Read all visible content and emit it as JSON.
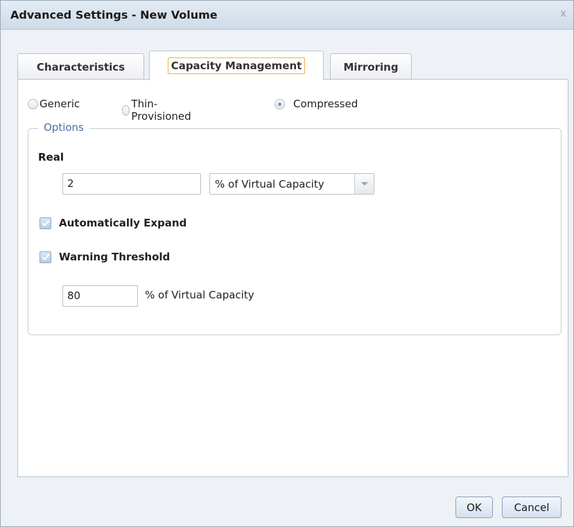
{
  "window": {
    "title": "Advanced Settings - New Volume",
    "close_glyph": "x"
  },
  "tabs": [
    {
      "label": "Characteristics",
      "active": false
    },
    {
      "label": "Capacity Management",
      "active": true
    },
    {
      "label": "Mirroring",
      "active": false
    }
  ],
  "provisioning": {
    "options": [
      {
        "label": "Generic",
        "checked": false
      },
      {
        "label": "Thin-Provisioned",
        "checked": false
      },
      {
        "label": "Compressed",
        "checked": true
      }
    ]
  },
  "options_group": {
    "legend": "Options",
    "real": {
      "label": "Real",
      "value": "2",
      "unit_selected": "% of Virtual Capacity"
    },
    "auto_expand": {
      "label": "Automatically Expand",
      "checked": true
    },
    "warning": {
      "label": "Warning Threshold",
      "checked": true,
      "value": "80",
      "unit": "% of Virtual Capacity"
    }
  },
  "buttons": {
    "ok": "OK",
    "cancel": "Cancel"
  },
  "colors": {
    "accent_focus": "#f2b046",
    "legend_text": "#4a6fa5",
    "titlebar": "#d9e3ee"
  },
  "icons": {
    "close": "close-icon",
    "dropdown": "chevron-down-icon",
    "check": "checkmark-icon"
  }
}
